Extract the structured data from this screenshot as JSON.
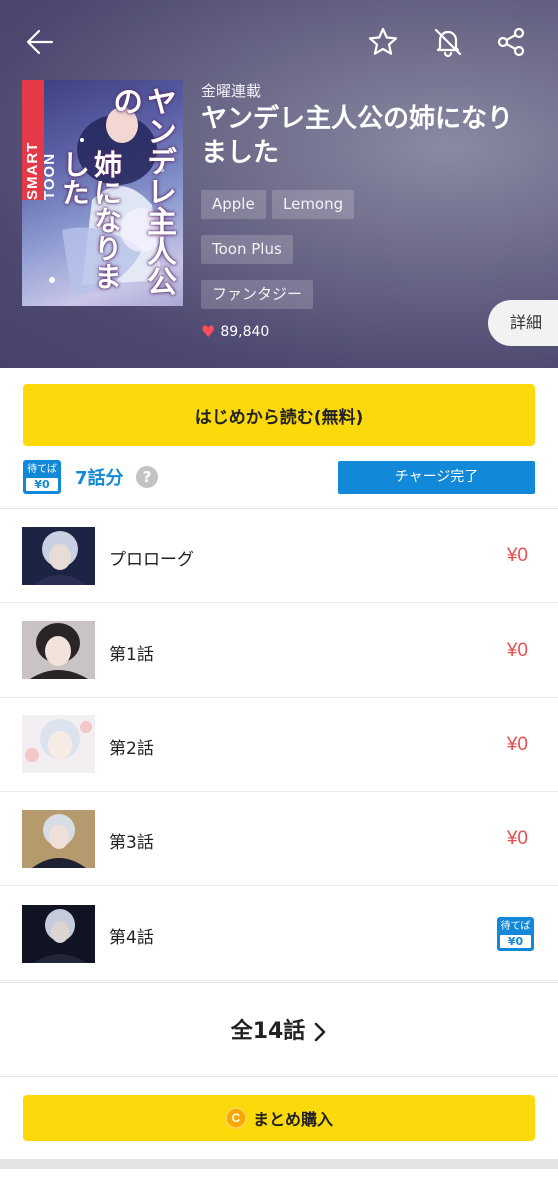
{
  "header": {
    "back_icon": "arrow-left-icon",
    "favorite_icon": "star-icon",
    "notification_icon": "bell-off-icon",
    "share_icon": "share-icon",
    "cover": {
      "badge": "SMART TOON",
      "title_line1": "ヤンデレ主人公の",
      "title_line2": "姉になりました"
    },
    "schedule": "金曜連載",
    "title": "ヤンデレ主人公の姉になりました",
    "tags": [
      "Apple",
      "Lemong",
      "Toon Plus",
      "ファンタジー"
    ],
    "likes": "89,840",
    "detail_label": "詳細"
  },
  "actions": {
    "read_free_label": "はじめから読む(無料)",
    "wait_badge_top": "待てば",
    "wait_badge_value": "¥0",
    "wait_count": "7話分",
    "help": "?",
    "charge_label": "チャージ完了"
  },
  "episodes": [
    {
      "title": "プロローグ",
      "price": "¥0",
      "wait": false
    },
    {
      "title": "第1話",
      "price": "¥0",
      "wait": false
    },
    {
      "title": "第2話",
      "price": "¥0",
      "wait": false
    },
    {
      "title": "第3話",
      "price": "¥0",
      "wait": false
    },
    {
      "title": "第4話",
      "price": "",
      "wait": true,
      "badge_top": "待てば",
      "badge_value": "¥0"
    }
  ],
  "all_episodes_label": "全14話",
  "bulk": {
    "coin_symbol": "C",
    "label": "まとめ購入"
  },
  "colors": {
    "accent_yellow": "#fcd90a",
    "accent_blue": "#1289d8",
    "price_red": "#e8504f"
  }
}
